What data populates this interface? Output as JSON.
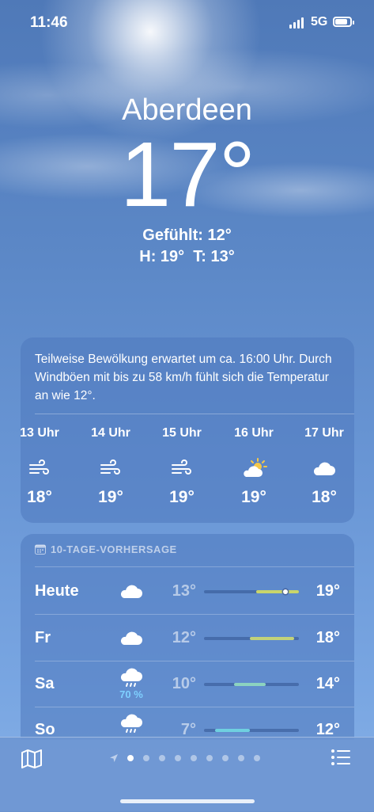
{
  "status": {
    "time": "11:46",
    "network": "5G"
  },
  "location": {
    "city": "Aberdeen",
    "temperature": "17°",
    "feels_like": "Gefühlt: 12°",
    "high_low": "H: 19°  T: 13°"
  },
  "hourly": {
    "summary": "Teilweise Bewölkung erwartet um ca. 16:00 Uhr. Durch Windböen mit bis zu 58 km/h fühlt sich die Temperatur an wie 12°.",
    "hours": [
      {
        "label": "13 Uhr",
        "icon": "wind-icon",
        "temp": "18°"
      },
      {
        "label": "14 Uhr",
        "icon": "wind-icon",
        "temp": "19°"
      },
      {
        "label": "15 Uhr",
        "icon": "wind-icon",
        "temp": "19°"
      },
      {
        "label": "16 Uhr",
        "icon": "partly-cloudy-sun-icon",
        "temp": "19°"
      },
      {
        "label": "17 Uhr",
        "icon": "cloud-icon",
        "temp": "18°"
      }
    ]
  },
  "forecast": {
    "title": "10-TAGE-VORHERSAGE",
    "days": [
      {
        "day": "Heute",
        "icon": "cloud-icon",
        "precip": "",
        "low": "13°",
        "high": "19°",
        "range_start": 0.55,
        "range_end": 1.0,
        "current": 0.86,
        "color": "#c9d56a"
      },
      {
        "day": "Fr",
        "icon": "cloud-icon",
        "precip": "",
        "low": "12°",
        "high": "18°",
        "range_start": 0.48,
        "range_end": 0.95,
        "color": "#c2d27a"
      },
      {
        "day": "Sa",
        "icon": "cloud-rain-icon",
        "precip": "70 %",
        "low": "10°",
        "high": "14°",
        "range_start": 0.32,
        "range_end": 0.65,
        "color": "#8cd3c0"
      },
      {
        "day": "So",
        "icon": "cloud-rain-icon",
        "precip": "",
        "low": "7°",
        "high": "12°",
        "range_start": 0.12,
        "range_end": 0.48,
        "color": "#6fd0e0"
      }
    ]
  },
  "pager": {
    "count": 9,
    "active": 0
  },
  "colors": {
    "accent_sun": "#f5c84a"
  }
}
